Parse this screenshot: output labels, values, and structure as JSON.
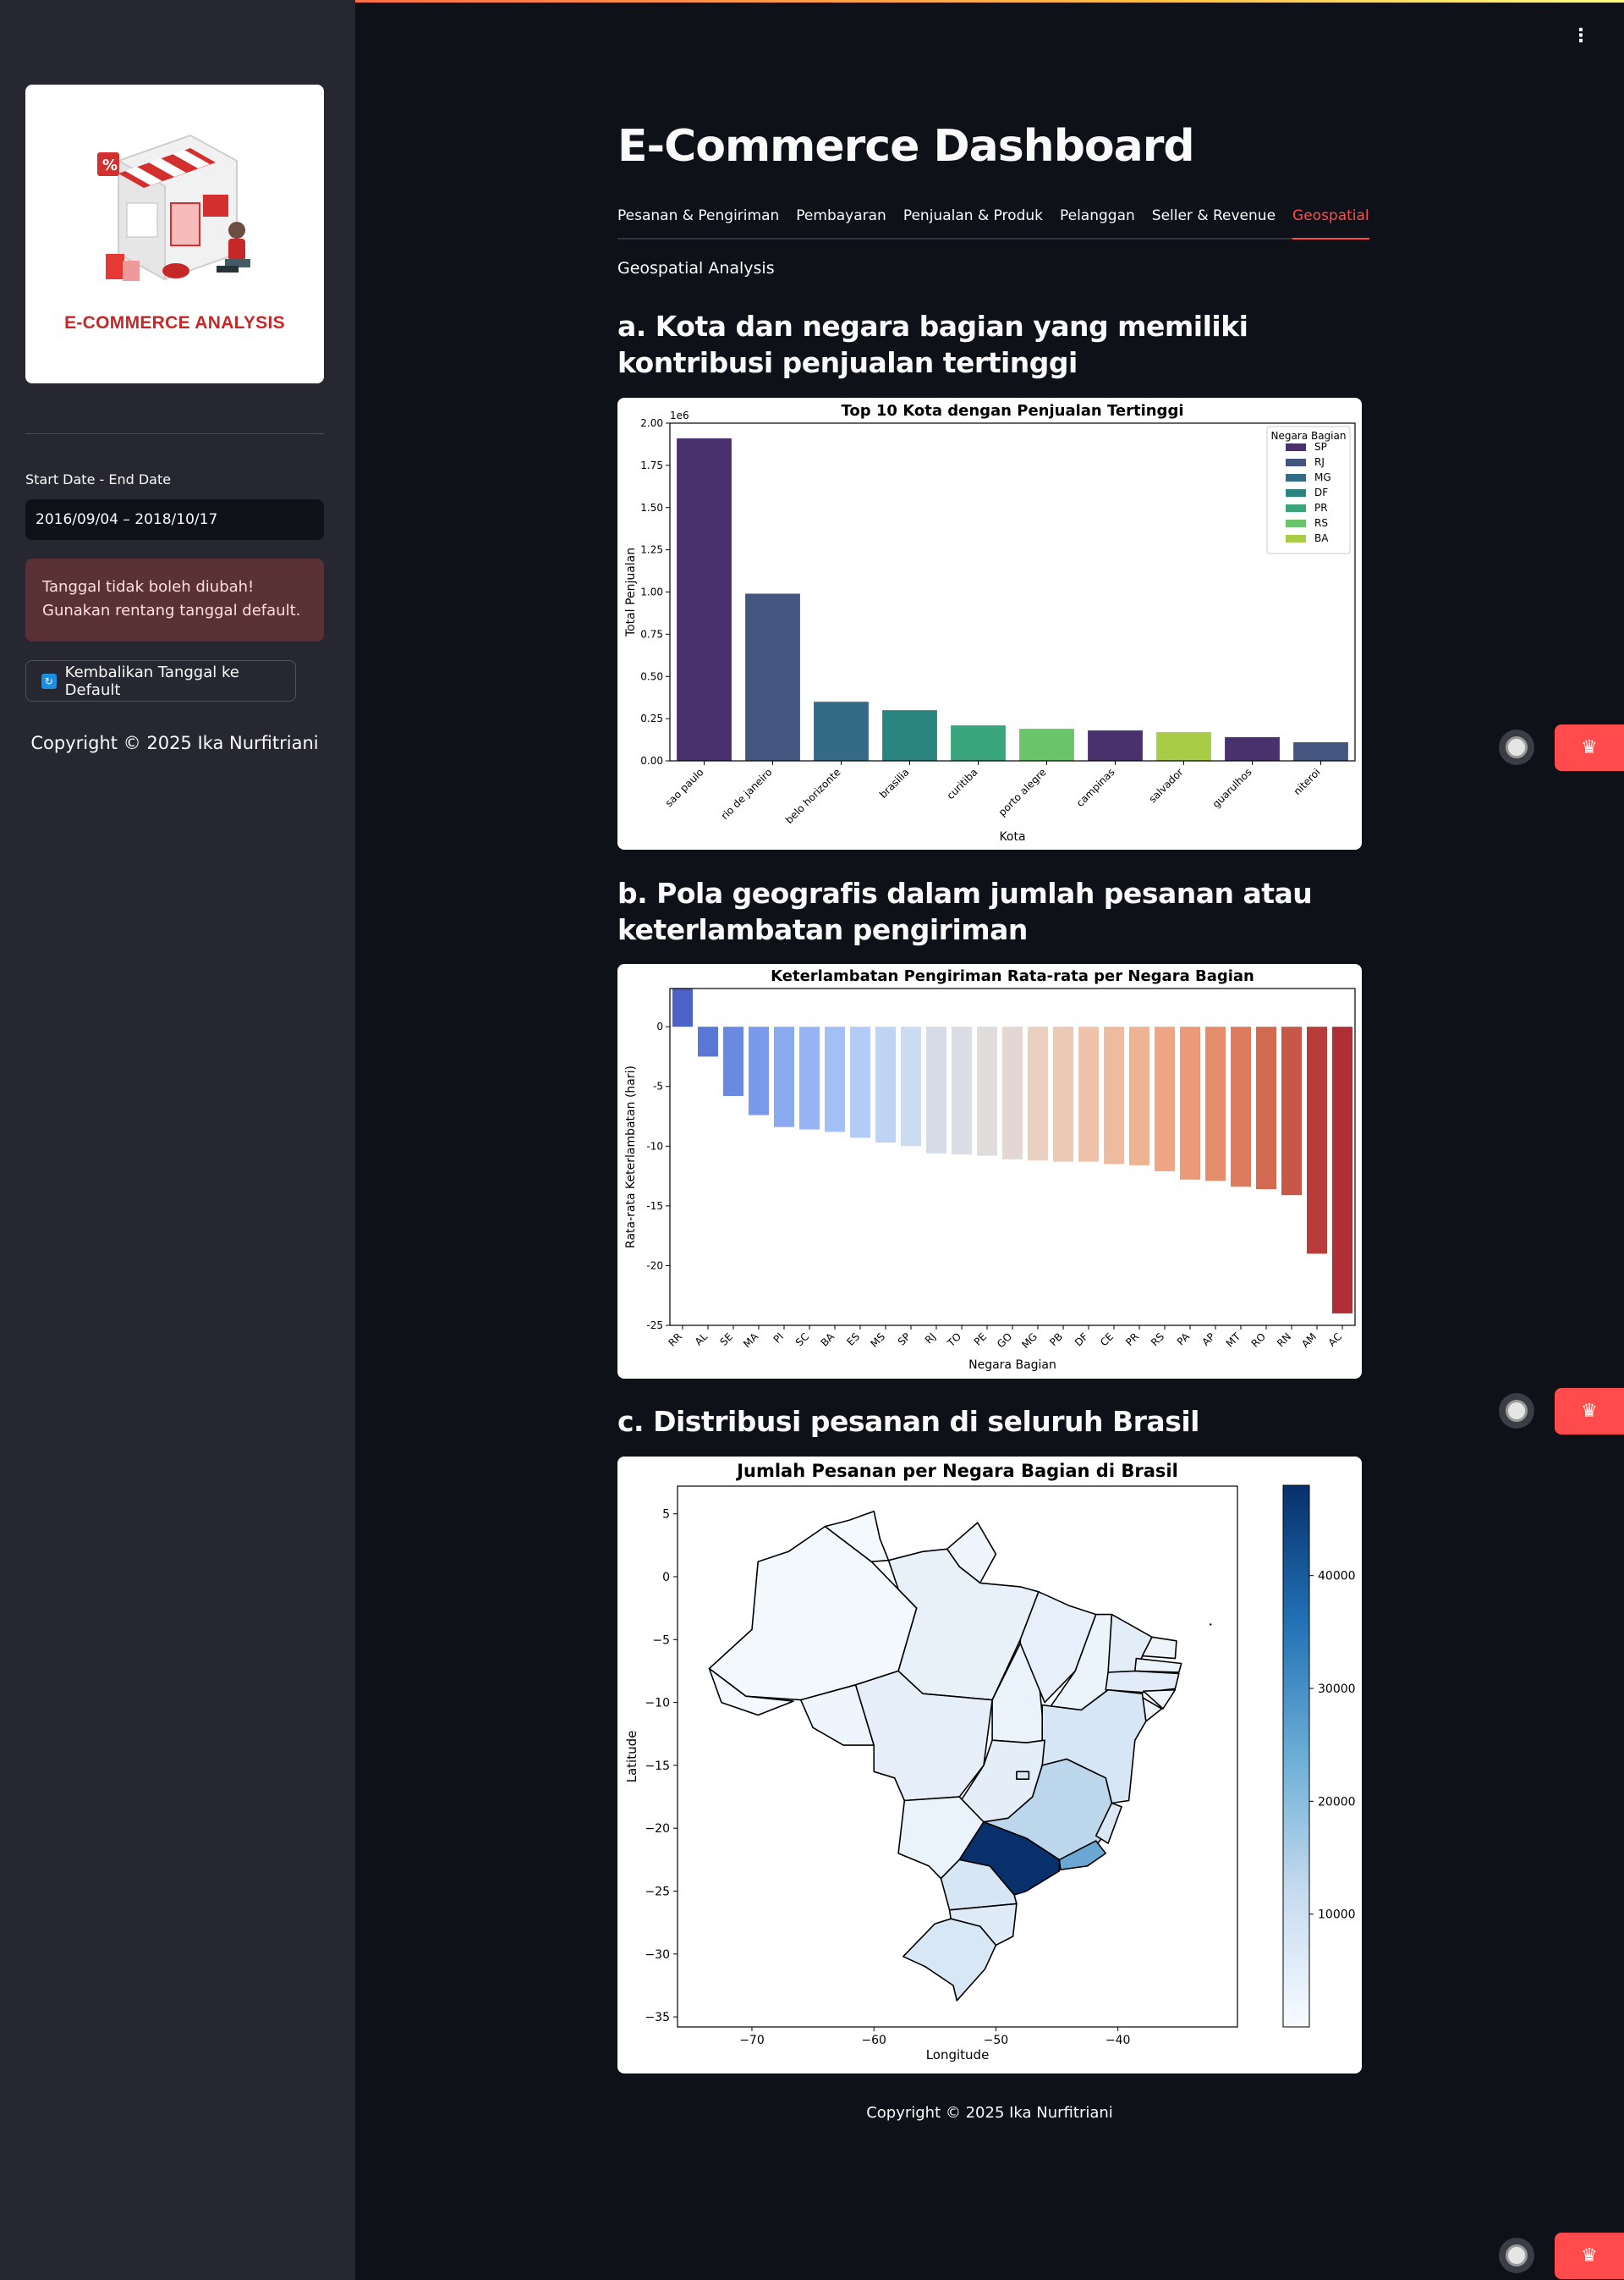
{
  "sidebar": {
    "logo_text": "E-COMMERCE ANALYSIS",
    "date_label": "Start Date - End Date",
    "date_value": "2016/09/04 – 2018/10/17",
    "warning": "Tanggal tidak boleh diubah! Gunakan rentang tanggal default.",
    "reset_button": "Kembalikan Tanggal ke Default",
    "copyright": "Copyright © 2025 Ika Nurfitriani"
  },
  "main": {
    "title": "E-Commerce Dashboard",
    "tabs": [
      "Pesanan & Pengiriman",
      "Pembayaran",
      "Penjualan & Produk",
      "Pelanggan",
      "Seller & Revenue",
      "Geospatial"
    ],
    "active_tab": "Geospatial",
    "subheader": "Geospatial Analysis",
    "section_a": "a. Kota dan negara bagian yang memiliki kontribusi penjualan tertinggi",
    "section_b": "b. Pola geografis dalam jumlah pesanan atau keterlambatan pengiriman",
    "section_c": "c. Distribusi pesanan di seluruh Brasil",
    "footer": "Copyright © 2025 Ika Nurfitriani"
  },
  "colors": {
    "accent": "#ff4b4b",
    "sidebar_bg": "#262730",
    "main_bg": "#0e1117"
  },
  "chart_data": [
    {
      "type": "bar",
      "title": "Top 10 Kota dengan Penjualan Tertinggi",
      "xlabel": "Kota",
      "ylabel": "Total Penjualan",
      "y_multiplier": "1e6",
      "ylim": [
        0,
        2.0
      ],
      "yticks": [
        "0.00",
        "0.25",
        "0.50",
        "0.75",
        "1.00",
        "1.25",
        "1.50",
        "1.75",
        "2.00"
      ],
      "categories": [
        "sao paulo",
        "rio de janeiro",
        "belo horizonte",
        "brasilia",
        "curitiba",
        "porto alegre",
        "campinas",
        "salvador",
        "guarulhos",
        "niteroi"
      ],
      "values": [
        1.91,
        0.99,
        0.35,
        0.3,
        0.21,
        0.19,
        0.18,
        0.17,
        0.14,
        0.11
      ],
      "states": [
        "SP",
        "RJ",
        "MG",
        "DF",
        "PR",
        "RS",
        "SP",
        "BA",
        "SP",
        "RJ"
      ],
      "legend_title": "Negara Bagian",
      "legend": [
        {
          "name": "SP",
          "color": "#48316c"
        },
        {
          "name": "RJ",
          "color": "#44567f"
        },
        {
          "name": "MG",
          "color": "#356a86"
        },
        {
          "name": "DF",
          "color": "#2a8480"
        },
        {
          "name": "PR",
          "color": "#3aa57c"
        },
        {
          "name": "RS",
          "color": "#6ac46a"
        },
        {
          "name": "BA",
          "color": "#a8cc45"
        }
      ],
      "legend_position": "top-right"
    },
    {
      "type": "bar",
      "title": "Keterlambatan Pengiriman Rata-rata per Negara Bagian",
      "xlabel": "Negara Bagian",
      "ylabel": "Rata-rata Keterlambatan (hari)",
      "ylim": [
        -25,
        3.2
      ],
      "yticks": [
        0,
        -5,
        -10,
        -15,
        -20,
        -25
      ],
      "categories": [
        "RR",
        "AL",
        "SE",
        "MA",
        "PI",
        "SC",
        "BA",
        "ES",
        "MS",
        "SP",
        "RJ",
        "TO",
        "PE",
        "GO",
        "MG",
        "PB",
        "DF",
        "CE",
        "PR",
        "RS",
        "PA",
        "AP",
        "MT",
        "RO",
        "RN",
        "AM",
        "AC"
      ],
      "values": [
        3.2,
        -2.5,
        -5.8,
        -7.4,
        -8.4,
        -8.6,
        -8.8,
        -9.3,
        -9.7,
        -10.0,
        -10.6,
        -10.7,
        -10.8,
        -11.1,
        -11.2,
        -11.3,
        -11.3,
        -11.5,
        -11.6,
        -12.1,
        -12.8,
        -12.9,
        -13.4,
        -13.6,
        -14.1,
        -19.0,
        -24.0
      ],
      "colors": [
        "#4c62c7",
        "#5a77d6",
        "#6a89e0",
        "#7a99e9",
        "#8aaaf0",
        "#96b4f4",
        "#a3c0f6",
        "#b2ccf7",
        "#bfd4f5",
        "#cbdbf1",
        "#d5dce8",
        "#dadde4",
        "#dfdcdc",
        "#e4d6d0",
        "#e9d0c3",
        "#ecc8b7",
        "#eec2ab",
        "#efbba0",
        "#efb293",
        "#eea685",
        "#ea9a78",
        "#e48c6b",
        "#dc7b5d",
        "#d26a51",
        "#c75849",
        "#b93c3d",
        "#b02e36"
      ],
      "grid": false
    },
    {
      "type": "heatmap",
      "title": "Jumlah Pesanan per Negara Bagian di Brasil",
      "xlabel": "Longitude",
      "ylabel": "Latitude",
      "xticks": [
        -70,
        -60,
        -50,
        -40
      ],
      "yticks": [
        5,
        0,
        -5,
        -10,
        -15,
        -20,
        -25,
        -30,
        -35
      ],
      "colorbar_ticks": [
        10000,
        20000,
        30000,
        40000
      ],
      "colorbar_range": [
        0,
        48000
      ],
      "colormap": "Blues",
      "highlighted_state": "SP"
    }
  ]
}
